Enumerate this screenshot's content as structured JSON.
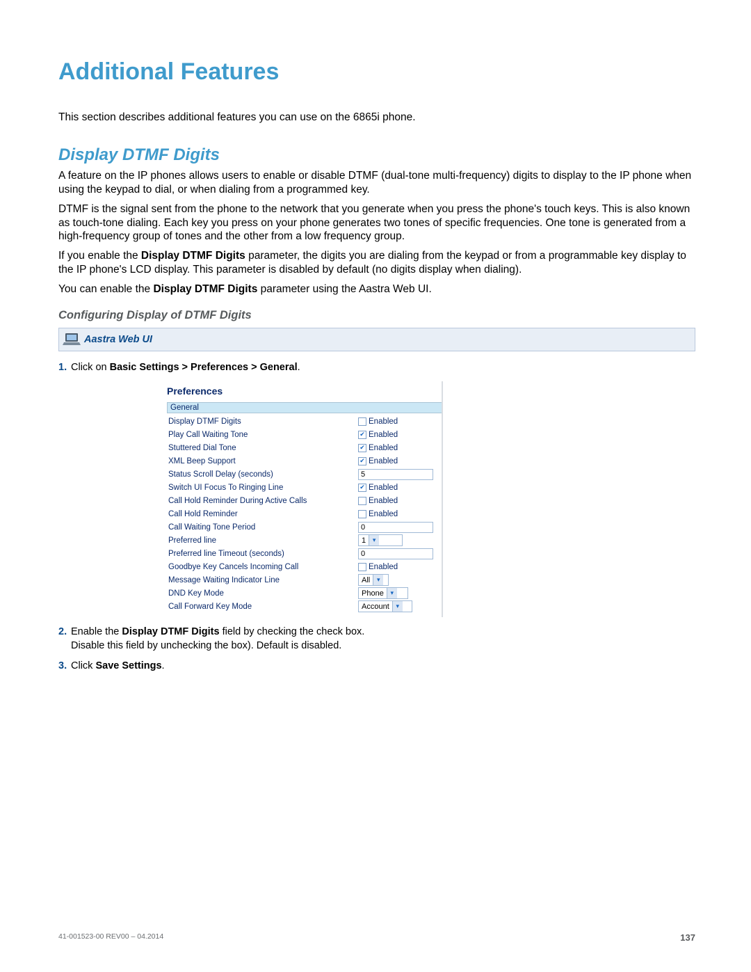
{
  "heading": "Additional Features",
  "intro": "This section describes additional features you can use on the 6865i phone.",
  "section_title": "Display DTMF Digits",
  "p1": "A feature on the IP phones allows users to enable or disable DTMF (dual-tone multi-frequency) digits to display to the IP phone when using the keypad to dial, or when dialing from a programmed key.",
  "p2": "DTMF is the signal sent from the phone to the network that you generate when you press the phone's touch keys. This is also known as touch-tone dialing. Each key you press on your phone generates two tones of specific frequencies. One tone is generated from a high-frequency group of tones and the other from a low frequency group.",
  "p3_a": "If you enable the ",
  "p3_b": "Display DTMF Digits",
  "p3_c": " parameter, the digits you are dialing from the keypad or from a programmable key display to the IP phone's LCD display. This parameter is disabled by default (no digits display when dialing).",
  "p4_a": "You can enable the ",
  "p4_b": "Display DTMF Digits",
  "p4_c": " parameter using the Aastra Web UI.",
  "sub_heading": "Configuring Display of DTMF Digits",
  "webui_label": "Aastra Web UI",
  "step1_a": "Click on ",
  "step1_b": "Basic Settings > Preferences > General",
  "step1_c": ".",
  "step2_a": "Enable the ",
  "step2_b": "Display DTMF Digits",
  "step2_c": " field by checking the check box.",
  "step2_line2": "Disable this field by unchecking the box). Default is disabled.",
  "step3_a": "Click ",
  "step3_b": "Save Settings",
  "step3_c": ".",
  "prefs_title": "Preferences",
  "general_header": "General",
  "enabled_text": "Enabled",
  "rows": {
    "r0": {
      "label": "Display DTMF Digits",
      "checked": false
    },
    "r1": {
      "label": "Play Call Waiting Tone",
      "checked": true
    },
    "r2": {
      "label": "Stuttered Dial Tone",
      "checked": true
    },
    "r3": {
      "label": "XML Beep Support",
      "checked": true
    },
    "r4": {
      "label": "Status Scroll Delay (seconds)",
      "value": "5"
    },
    "r5": {
      "label": "Switch UI Focus To Ringing Line",
      "checked": true
    },
    "r6": {
      "label": "Call Hold Reminder During Active Calls",
      "checked": false
    },
    "r7": {
      "label": "Call Hold Reminder",
      "checked": false
    },
    "r8": {
      "label": "Call Waiting Tone Period",
      "value": "0"
    },
    "r9": {
      "label": "Preferred line",
      "select": "1"
    },
    "r10": {
      "label": "Preferred line Timeout (seconds)",
      "value": "0"
    },
    "r11": {
      "label": "Goodbye Key Cancels Incoming Call",
      "checked": false
    },
    "r12": {
      "label": "Message Waiting Indicator Line",
      "select": "All"
    },
    "r13": {
      "label": "DND Key Mode",
      "select": "Phone"
    },
    "r14": {
      "label": "Call Forward Key Mode",
      "select": "Account"
    }
  },
  "footer_left": "41-001523-00 REV00 – 04.2014",
  "footer_right": "137"
}
